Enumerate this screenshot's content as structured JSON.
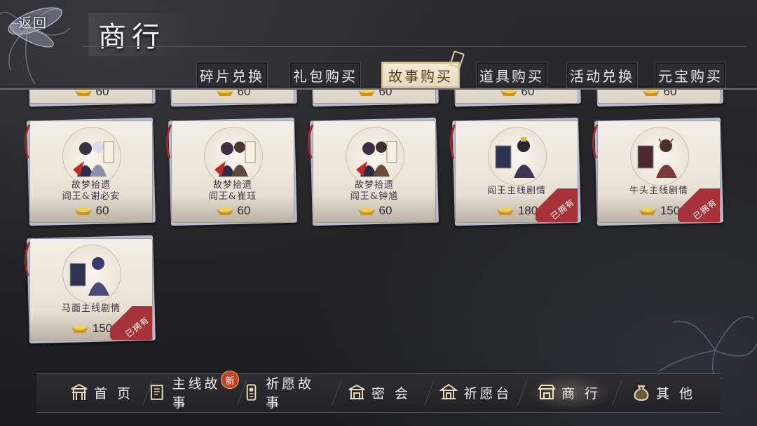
{
  "header": {
    "back_label": "返回",
    "title": "商行"
  },
  "tabs": [
    {
      "label": "碎片兑换",
      "active": false
    },
    {
      "label": "礼包购买",
      "active": false
    },
    {
      "label": "故事购买",
      "active": true
    },
    {
      "label": "道具购买",
      "active": false
    },
    {
      "label": "活动兑换",
      "active": false
    },
    {
      "label": "元宝购买",
      "active": false
    }
  ],
  "partial_row_prices": [
    "60",
    "60",
    "60",
    "60",
    "60"
  ],
  "items": [
    {
      "line1": "故梦拾遗",
      "line2": "阎王&谢必安",
      "price": "60",
      "owned": false
    },
    {
      "line1": "故梦拾遗",
      "line2": "阎王&崔珏",
      "price": "60",
      "owned": false
    },
    {
      "line1": "故梦拾遗",
      "line2": "阎王&钟馗",
      "price": "60",
      "owned": false
    },
    {
      "line1": "阎王主线剧情",
      "line2": "",
      "price": "180",
      "owned": true
    },
    {
      "line1": "牛头主线剧情",
      "line2": "",
      "price": "150",
      "owned": true
    },
    {
      "line1": "马面主线剧情",
      "line2": "",
      "price": "150",
      "owned": true
    }
  ],
  "owned_label": "已拥有",
  "nav": [
    {
      "label": "首 页",
      "icon": "gate-icon",
      "badge": ""
    },
    {
      "label": "主线故事",
      "icon": "book-icon",
      "badge": "新"
    },
    {
      "label": "祈愿故事",
      "icon": "talisman-icon",
      "badge": ""
    },
    {
      "label": "密 会",
      "icon": "pavilion-icon",
      "badge": ""
    },
    {
      "label": "祈愿台",
      "icon": "shrine-icon",
      "badge": ""
    },
    {
      "label": "商 行",
      "icon": "shop-icon",
      "badge": "",
      "active": true
    },
    {
      "label": "其 他",
      "icon": "pouch-icon",
      "badge": ""
    }
  ],
  "colors": {
    "accent": "#e5d8bd",
    "owned": "#a7323a",
    "background": "#232325"
  }
}
